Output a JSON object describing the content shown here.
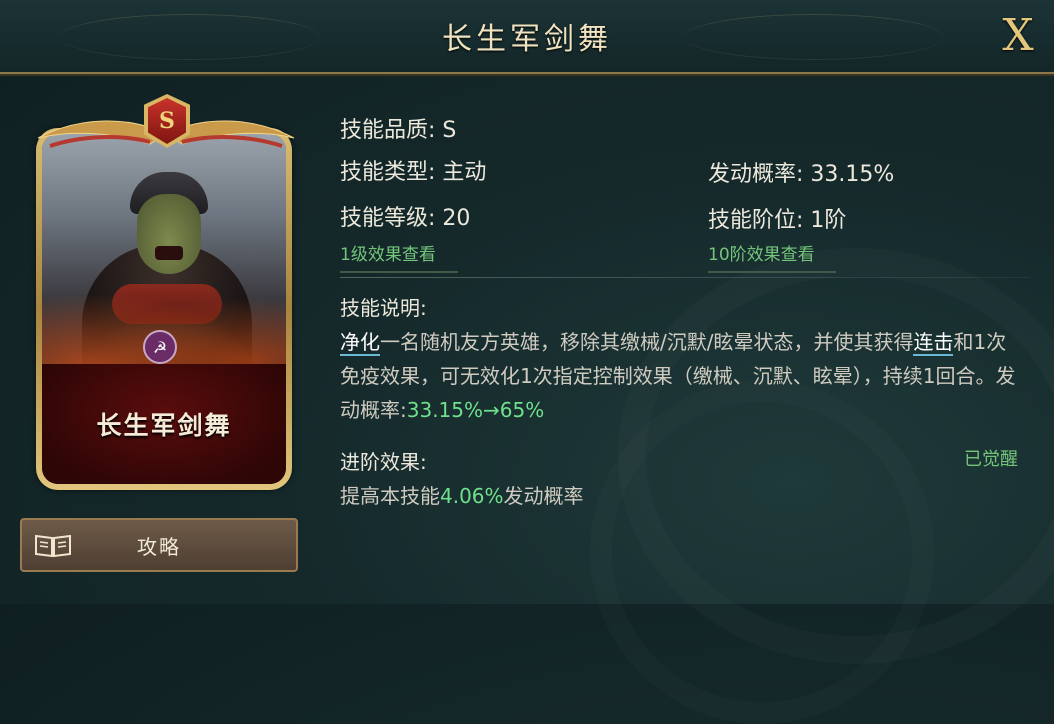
{
  "header": {
    "title": "长生军剑舞",
    "close_label": "X"
  },
  "card": {
    "grade": "S",
    "name": "长生军剑舞",
    "emblem_glyph": "☭"
  },
  "guide_button": {
    "label": "攻略"
  },
  "skill": {
    "quality": "技能品质: S",
    "type": "技能类型: 主动",
    "trigger_rate": "发动概率: 33.15%",
    "level": "技能等级: 20",
    "tier": "技能阶位: 1阶",
    "level1_link": "1级效果查看",
    "tier10_link": "10阶效果查看"
  },
  "description": {
    "title": "技能说明:",
    "kw1": "净化",
    "text1": "一名随机友方英雄，移除其缴械/沉默/眩晕状态，并使其获得",
    "kw2": "连击",
    "text2": "和1次免疫效果，可无效化1次指定控制效果（缴械、沉默、眩晕），持续1回合。发动概率:",
    "rate_change": "33.15%→65%"
  },
  "advance": {
    "title": "进阶效果:",
    "status": "已觉醒",
    "prefix": "提高本技能",
    "value": "4.06%",
    "suffix": "发动概率"
  },
  "colors": {
    "accent_green": "#6fe08c",
    "gold": "#e4c77c",
    "keyword_underline": "#6ab9d2"
  }
}
